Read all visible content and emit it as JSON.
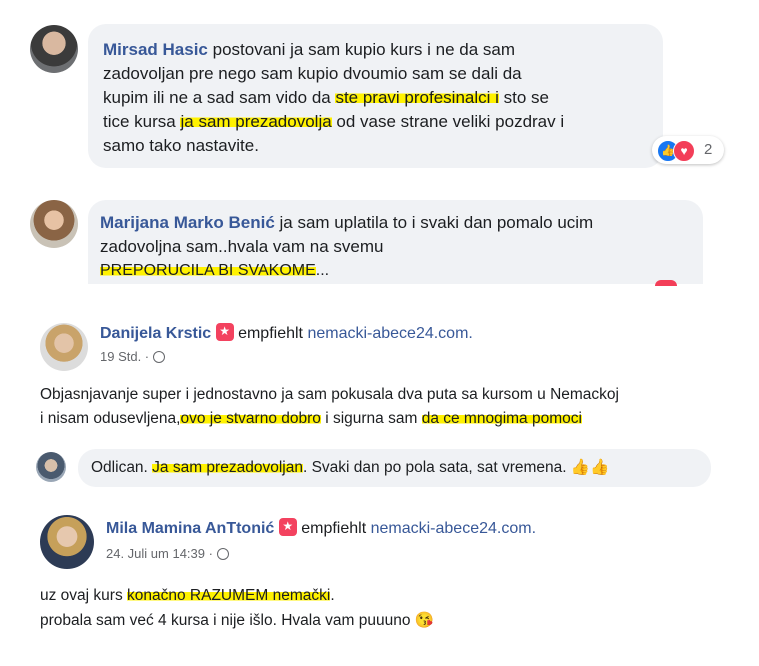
{
  "comment1": {
    "author": "Mirsad Hasic",
    "lines": [
      {
        "pre": "postovani ja sam kupio kurs i ne da sam"
      },
      {
        "pre": "zadovoljan pre nego sam kupio dvoumio sam se dali da"
      },
      {
        "pre": "kupim ili ne a sad sam vido da ",
        "hl": "ste pravi profesinalci i",
        "post": " sto se"
      },
      {
        "pre": "tice kursa ",
        "hl": "ja sam prezadovolja",
        "post": " od vase strane veliki pozdrav i"
      },
      {
        "pre": "samo tako nastavite."
      }
    ],
    "reaction_count": "2"
  },
  "comment2": {
    "author": "Marijana Marko Benić",
    "lines": [
      {
        "pre": "ja sam uplatila to i svaki dan pomalo ucim"
      },
      {
        "pre": "zadovoljna sam..hvala vam na svemu"
      },
      {
        "hl": "PREPORUCILA BI SVAKOME",
        "post": "..."
      }
    ]
  },
  "post1": {
    "author": "Danijela Krstic",
    "recommends": "empfiehlt",
    "page": "nemacki-abece24.com.",
    "time": "19 Std. ·",
    "lines": [
      {
        "pre": "Objasnjavanje super i jednostavno ja sam pokusala dva puta sa kursom u Nemackoj"
      },
      {
        "pre": "i nisam odusevljena,",
        "hl": "ovo je stvarno dobro",
        "post": " i sigurna sam ",
        "hl2": "da ce mnogima pomoci"
      }
    ],
    "reply": {
      "pre": "Odlican. ",
      "hl": "Ja sam prezadovoljan",
      "post": ". Svaki dan po pola sata, sat vremena. 👍👍"
    }
  },
  "post2": {
    "author": "Mila Mamina AnTtonić",
    "recommends": "empfiehlt",
    "page": "nemacki-abece24.com.",
    "time": "24. Juli um 14:39 ·",
    "lines": [
      {
        "pre": "uz ovaj kurs ",
        "hl": "konačno RAZUMEM nemački",
        "post": "."
      },
      {
        "pre": "probala sam već 4 kursa i nije išlo. Hvala vam puuuno 😘"
      }
    ]
  },
  "colors": {
    "link": "#385898",
    "highlight": "#fff200",
    "bubble": "#f0f2f5",
    "recommend": "#f3425f"
  }
}
